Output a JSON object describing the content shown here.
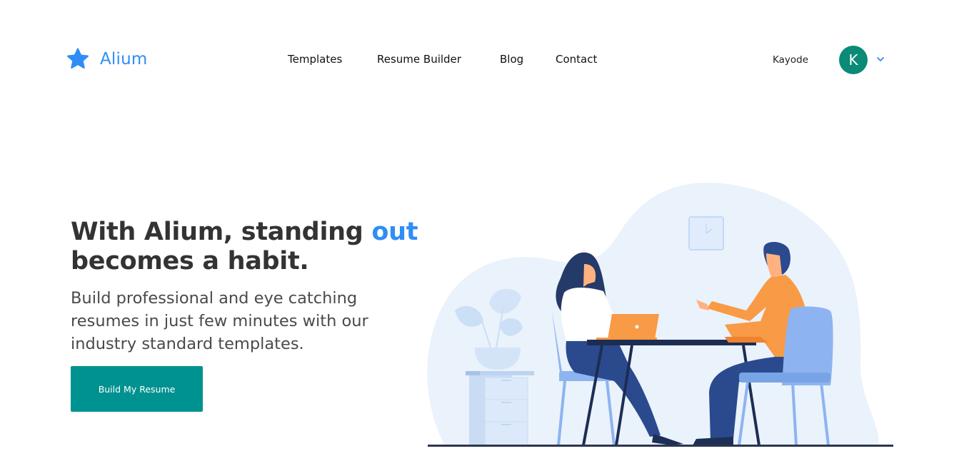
{
  "brand": {
    "name": "Alium",
    "logo_icon": "star-icon",
    "accent_color": "#2f8ef6"
  },
  "nav": {
    "links": [
      {
        "label": "Templates"
      },
      {
        "label": "Resume Builder"
      },
      {
        "label": "Blog"
      },
      {
        "label": "Contact"
      }
    ]
  },
  "user": {
    "name": "Kayode",
    "avatar_initial": "K",
    "avatar_color": "#0b8a78",
    "menu_icon": "chevron-down-icon"
  },
  "hero": {
    "title_part1": "With Alium, standing ",
    "title_accent": "out",
    "title_part2": "becomes a habit.",
    "subtitle": "Build professional and eye catching resumes in just few minutes with our industry standard templates.",
    "cta_label": "Build My Resume",
    "cta_color": "#009290"
  },
  "illustration": {
    "description": "Two people seated at a table in an interview, woman with laptop, man gesturing; wall clock and potted plant on a cabinet"
  }
}
